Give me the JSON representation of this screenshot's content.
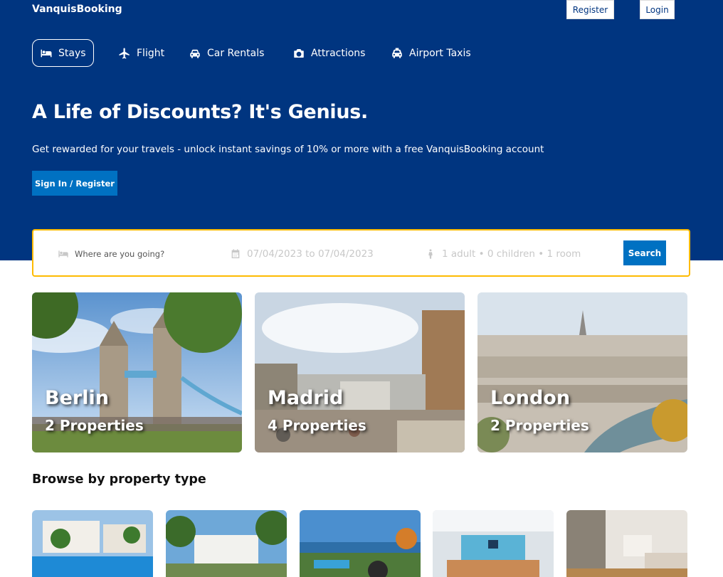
{
  "header": {
    "logo": "VanquisBooking",
    "register_label": "Register",
    "login_label": "Login"
  },
  "nav": {
    "items": [
      {
        "label": "Stays",
        "icon": "bed-icon",
        "active": true
      },
      {
        "label": "Flight",
        "icon": "plane-icon",
        "active": false
      },
      {
        "label": "Car Rentals",
        "icon": "car-icon",
        "active": false
      },
      {
        "label": "Attractions",
        "icon": "camera-icon",
        "active": false
      },
      {
        "label": "Airport Taxis",
        "icon": "taxi-icon",
        "active": false
      }
    ]
  },
  "hero": {
    "headline": "A Life of Discounts? It's Genius.",
    "subline": "Get rewarded for your travels - unlock instant savings of 10% or more with a free VanquisBooking account",
    "signin_label": "Sign In / Register"
  },
  "search": {
    "destination_placeholder": "Where are you going?",
    "dates": "07/04/2023 to 07/04/2023",
    "occupancy": "1 adult • 0 children • 1 room",
    "button_label": "Search"
  },
  "cities": [
    {
      "name": "Berlin",
      "properties": "2 Properties"
    },
    {
      "name": "Madrid",
      "properties": "4 Properties"
    },
    {
      "name": "London",
      "properties": "2 Properties"
    }
  ],
  "property_types": {
    "title": "Browse by property type"
  },
  "colors": {
    "brand": "#003580",
    "accent": "#0071c2",
    "search_border": "#febb02"
  }
}
